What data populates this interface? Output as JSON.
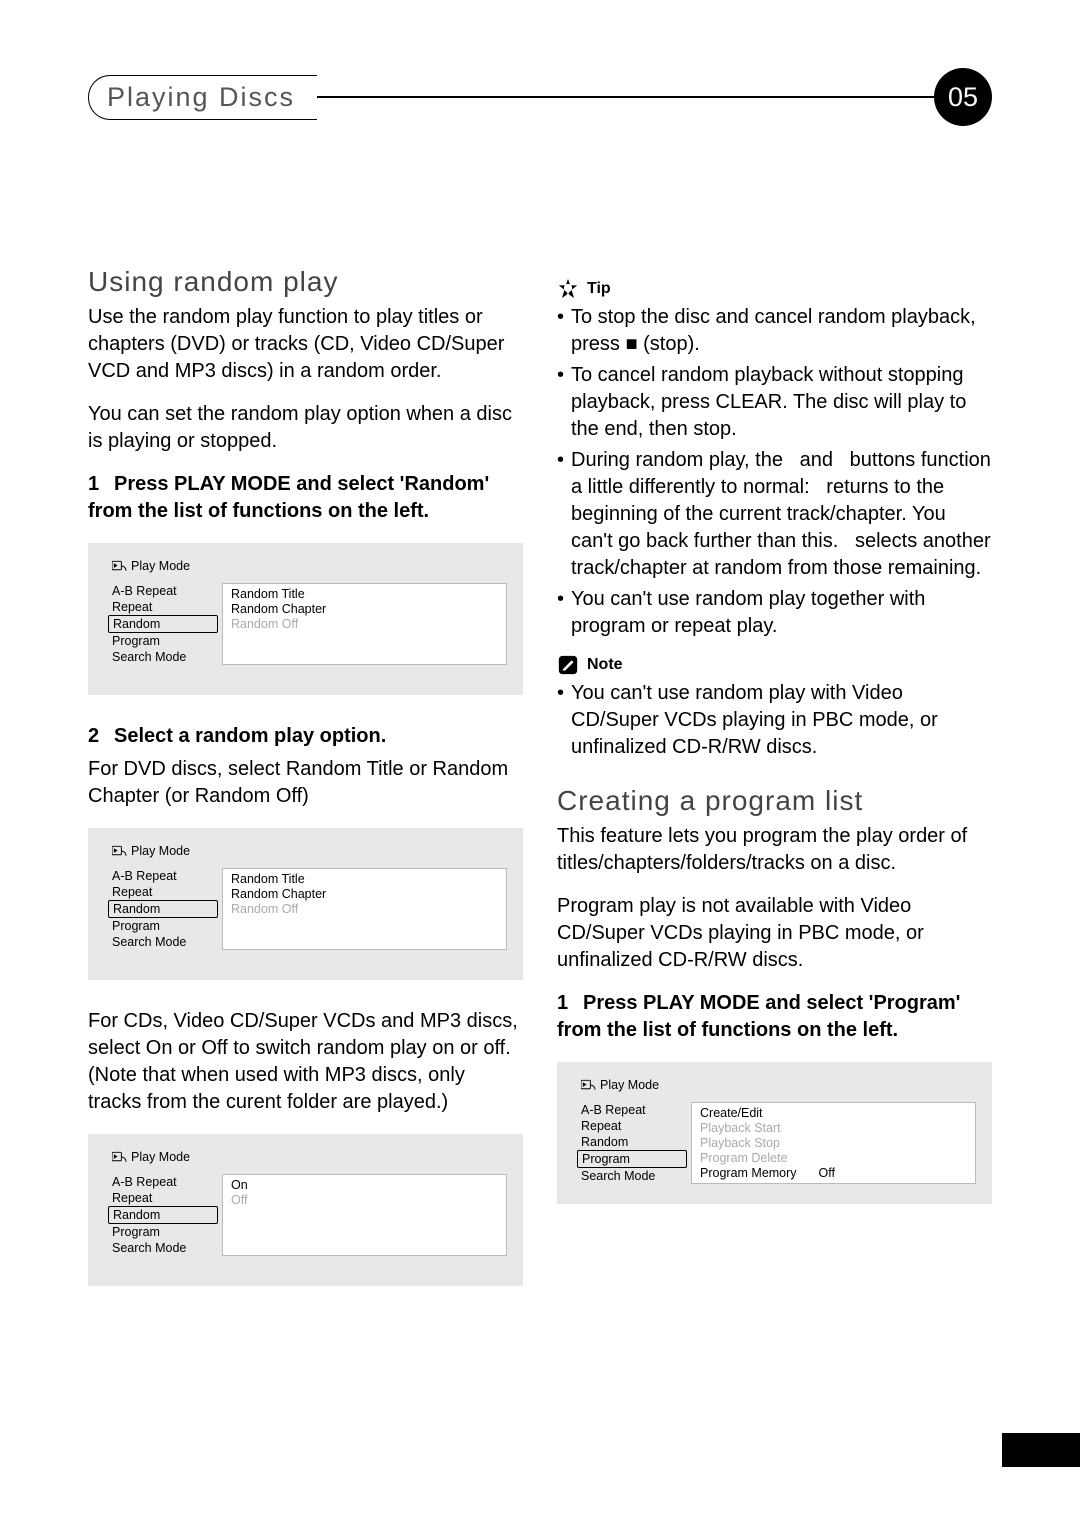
{
  "header": {
    "chapter": "Playing Discs",
    "page_number": "05"
  },
  "left": {
    "h2": "Using random play",
    "intro1": "Use the random play function to play titles or chapters (DVD) or tracks (CD, Video CD/Super VCD and MP3 discs) in a random order.",
    "intro2": "You can set the random play option when a disc is playing or stopped.",
    "step1_num": "1",
    "step1": "Press PLAY MODE and select 'Random' from the list of functions on the left.",
    "menu1": {
      "title": "Play Mode",
      "left": [
        "A-B Repeat",
        "Repeat",
        "Random",
        "Program",
        "Search Mode"
      ],
      "selected": "Random",
      "right": [
        {
          "label": "Random Title",
          "dim": false
        },
        {
          "label": "Random Chapter",
          "dim": false
        },
        {
          "label": "Random Off",
          "dim": true
        }
      ]
    },
    "step2_num": "2",
    "step2": "Select a random play option.",
    "step2_sub": "For DVD discs, select Random Title or Random Chapter (or Random Off)",
    "menu2": {
      "title": "Play Mode",
      "left": [
        "A-B Repeat",
        "Repeat",
        "Random",
        "Program",
        "Search Mode"
      ],
      "selected": "Random",
      "right": [
        {
          "label": "Random Title",
          "dim": false
        },
        {
          "label": "Random Chapter",
          "dim": false
        },
        {
          "label": "Random Off",
          "dim": true
        }
      ]
    },
    "para_cd": "For CDs, Video CD/Super VCDs and MP3 discs, select On or Off to switch random play on or off. (Note that when used with MP3 discs, only tracks from the curent folder are played.)",
    "menu3": {
      "title": "Play Mode",
      "left": [
        "A-B Repeat",
        "Repeat",
        "Random",
        "Program",
        "Search Mode"
      ],
      "selected": "Random",
      "right": [
        {
          "label": "On",
          "dim": false
        },
        {
          "label": "Off",
          "dim": true
        }
      ]
    }
  },
  "right": {
    "tip_label": "Tip",
    "tips": [
      "To stop the disc and cancel random playback, press ■ (stop).",
      "To cancel random playback without stopping playback, press CLEAR. The disc will play to the end, then stop.",
      "During random play, the   and   buttons function a little differently to normal:   returns to the beginning of the current track/chapter. You can't go back further than this.   selects another track/chapter at random from those remaining.",
      "You can't use random play together with program or repeat play."
    ],
    "note_label": "Note",
    "notes": [
      "You can't use random play with Video CD/Super VCDs playing in PBC mode, or unfinalized CD-R/RW discs."
    ],
    "h2b": "Creating a program list",
    "prog_p1": "This feature lets you program the play order of titles/chapters/folders/tracks on a disc.",
    "prog_p2": "Program play is not available with Video CD/Super VCDs playing in PBC mode, or unfinalized CD-R/RW discs.",
    "prog_step1_num": "1",
    "prog_step1": "Press PLAY MODE and select 'Program' from the list of functions on the left.",
    "menu4": {
      "title": "Play Mode",
      "left": [
        "A-B Repeat",
        "Repeat",
        "Random",
        "Program",
        "Search Mode"
      ],
      "selected": "Program",
      "right": [
        {
          "label": "Create/Edit",
          "dim": false
        },
        {
          "label": "Playback Start",
          "dim": true
        },
        {
          "label": "Playback Stop",
          "dim": true
        },
        {
          "label": "Program Delete",
          "dim": true
        },
        {
          "label": "Program Memory",
          "dim": false,
          "suffix": "Off"
        }
      ]
    }
  }
}
